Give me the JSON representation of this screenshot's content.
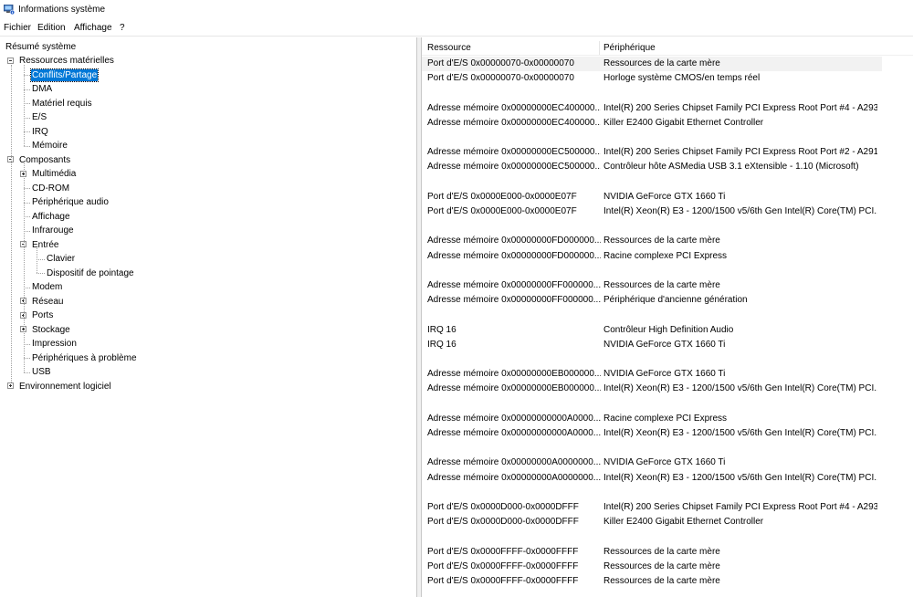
{
  "window": {
    "title": "Informations système"
  },
  "menu": [
    "Fichier",
    "Edition",
    "Affichage",
    "?"
  ],
  "tree": [
    {
      "label": "Résumé système",
      "level": 0,
      "expander": "none",
      "name": "tree-item-resume-systeme"
    },
    {
      "label": "Ressources matérielles",
      "level": 1,
      "expander": "minus",
      "name": "tree-item-ressources-materielles"
    },
    {
      "label": "Conflits/Partage",
      "level": 2,
      "expander": "none",
      "selected": true,
      "name": "tree-item-conflits-partage"
    },
    {
      "label": "DMA",
      "level": 2,
      "expander": "none",
      "name": "tree-item-dma"
    },
    {
      "label": "Matériel requis",
      "level": 2,
      "expander": "none",
      "name": "tree-item-materiel-requis"
    },
    {
      "label": "E/S",
      "level": 2,
      "expander": "none",
      "name": "tree-item-es"
    },
    {
      "label": "IRQ",
      "level": 2,
      "expander": "none",
      "name": "tree-item-irq"
    },
    {
      "label": "Mémoire",
      "level": 2,
      "expander": "none",
      "name": "tree-item-memoire"
    },
    {
      "label": "Composants",
      "level": 1,
      "expander": "minus",
      "name": "tree-item-composants"
    },
    {
      "label": "Multimédia",
      "level": 2,
      "expander": "plus",
      "name": "tree-item-multimedia"
    },
    {
      "label": "CD-ROM",
      "level": 2,
      "expander": "none",
      "name": "tree-item-cd-rom"
    },
    {
      "label": "Périphérique audio",
      "level": 2,
      "expander": "none",
      "name": "tree-item-peripherique-audio"
    },
    {
      "label": "Affichage",
      "level": 2,
      "expander": "none",
      "name": "tree-item-affichage"
    },
    {
      "label": "Infrarouge",
      "level": 2,
      "expander": "none",
      "name": "tree-item-infrarouge"
    },
    {
      "label": "Entrée",
      "level": 2,
      "expander": "minus",
      "name": "tree-item-entree"
    },
    {
      "label": "Clavier",
      "level": 3,
      "expander": "none",
      "name": "tree-item-clavier"
    },
    {
      "label": "Dispositif de pointage",
      "level": 3,
      "expander": "none",
      "name": "tree-item-dispositif-pointage"
    },
    {
      "label": "Modem",
      "level": 2,
      "expander": "none",
      "name": "tree-item-modem"
    },
    {
      "label": "Réseau",
      "level": 2,
      "expander": "plus",
      "name": "tree-item-reseau"
    },
    {
      "label": "Ports",
      "level": 2,
      "expander": "plus",
      "name": "tree-item-ports"
    },
    {
      "label": "Stockage",
      "level": 2,
      "expander": "plus",
      "name": "tree-item-stockage"
    },
    {
      "label": "Impression",
      "level": 2,
      "expander": "none",
      "name": "tree-item-impression"
    },
    {
      "label": "Périphériques à problème",
      "level": 2,
      "expander": "none",
      "name": "tree-item-peripheriques-probleme"
    },
    {
      "label": "USB",
      "level": 2,
      "expander": "none",
      "name": "tree-item-usb"
    },
    {
      "label": "Environnement logiciel",
      "level": 1,
      "expander": "plus",
      "name": "tree-item-environnement-logiciel"
    }
  ],
  "table": {
    "columns": [
      "Ressource",
      "Périphérique"
    ],
    "rows": [
      [
        "Port d'E/S 0x00000070-0x00000070",
        "Ressources de la carte mère"
      ],
      [
        "Port d'E/S 0x00000070-0x00000070",
        "Horloge système CMOS/en temps réel"
      ],
      [
        "",
        ""
      ],
      [
        "Adresse mémoire 0x00000000EC400000...",
        "Intel(R) 200 Series Chipset Family PCI Express Root Port #4 - A293"
      ],
      [
        "Adresse mémoire 0x00000000EC400000...",
        "Killer E2400 Gigabit Ethernet Controller"
      ],
      [
        "",
        ""
      ],
      [
        "Adresse mémoire 0x00000000EC500000...",
        "Intel(R) 200 Series Chipset Family PCI Express Root Port #2 - A291"
      ],
      [
        "Adresse mémoire 0x00000000EC500000...",
        "Contrôleur hôte ASMedia USB 3.1 eXtensible - 1.10 (Microsoft)"
      ],
      [
        "",
        ""
      ],
      [
        "Port d'E/S 0x0000E000-0x0000E07F",
        "NVIDIA GeForce GTX 1660 Ti"
      ],
      [
        "Port d'E/S 0x0000E000-0x0000E07F",
        "Intel(R) Xeon(R) E3 - 1200/1500 v5/6th Gen Intel(R) Core(TM) PCI..."
      ],
      [
        "",
        ""
      ],
      [
        "Adresse mémoire 0x00000000FD000000...",
        "Ressources de la carte mère"
      ],
      [
        "Adresse mémoire 0x00000000FD000000...",
        "Racine complexe PCI Express"
      ],
      [
        "",
        ""
      ],
      [
        "Adresse mémoire 0x00000000FF000000...",
        "Ressources de la carte mère"
      ],
      [
        "Adresse mémoire 0x00000000FF000000...",
        "Périphérique d'ancienne génération"
      ],
      [
        "",
        ""
      ],
      [
        "IRQ 16",
        "Contrôleur High Definition Audio"
      ],
      [
        "IRQ 16",
        "NVIDIA GeForce GTX 1660 Ti"
      ],
      [
        "",
        ""
      ],
      [
        "Adresse mémoire 0x00000000EB000000...",
        "NVIDIA GeForce GTX 1660 Ti"
      ],
      [
        "Adresse mémoire 0x00000000EB000000...",
        "Intel(R) Xeon(R) E3 - 1200/1500 v5/6th Gen Intel(R) Core(TM) PCI..."
      ],
      [
        "",
        ""
      ],
      [
        "Adresse mémoire 0x00000000000A0000...",
        "Racine complexe PCI Express"
      ],
      [
        "Adresse mémoire 0x00000000000A0000...",
        "Intel(R) Xeon(R) E3 - 1200/1500 v5/6th Gen Intel(R) Core(TM) PCI..."
      ],
      [
        "",
        ""
      ],
      [
        "Adresse mémoire 0x00000000A0000000...",
        "NVIDIA GeForce GTX 1660 Ti"
      ],
      [
        "Adresse mémoire 0x00000000A0000000...",
        "Intel(R) Xeon(R) E3 - 1200/1500 v5/6th Gen Intel(R) Core(TM) PCI..."
      ],
      [
        "",
        ""
      ],
      [
        "Port d'E/S 0x0000D000-0x0000DFFF",
        "Intel(R) 200 Series Chipset Family PCI Express Root Port #4 - A293"
      ],
      [
        "Port d'E/S 0x0000D000-0x0000DFFF",
        "Killer E2400 Gigabit Ethernet Controller"
      ],
      [
        "",
        ""
      ],
      [
        "Port d'E/S 0x0000FFFF-0x0000FFFF",
        "Ressources de la carte mère"
      ],
      [
        "Port d'E/S 0x0000FFFF-0x0000FFFF",
        "Ressources de la carte mère"
      ],
      [
        "Port d'E/S 0x0000FFFF-0x0000FFFF",
        "Ressources de la carte mère"
      ]
    ],
    "highlighted_row": 0
  },
  "colors": {
    "selection": "#0078d7",
    "row_highlight": "#f2f2f2"
  },
  "icons": {
    "app": "system-information-icon"
  }
}
